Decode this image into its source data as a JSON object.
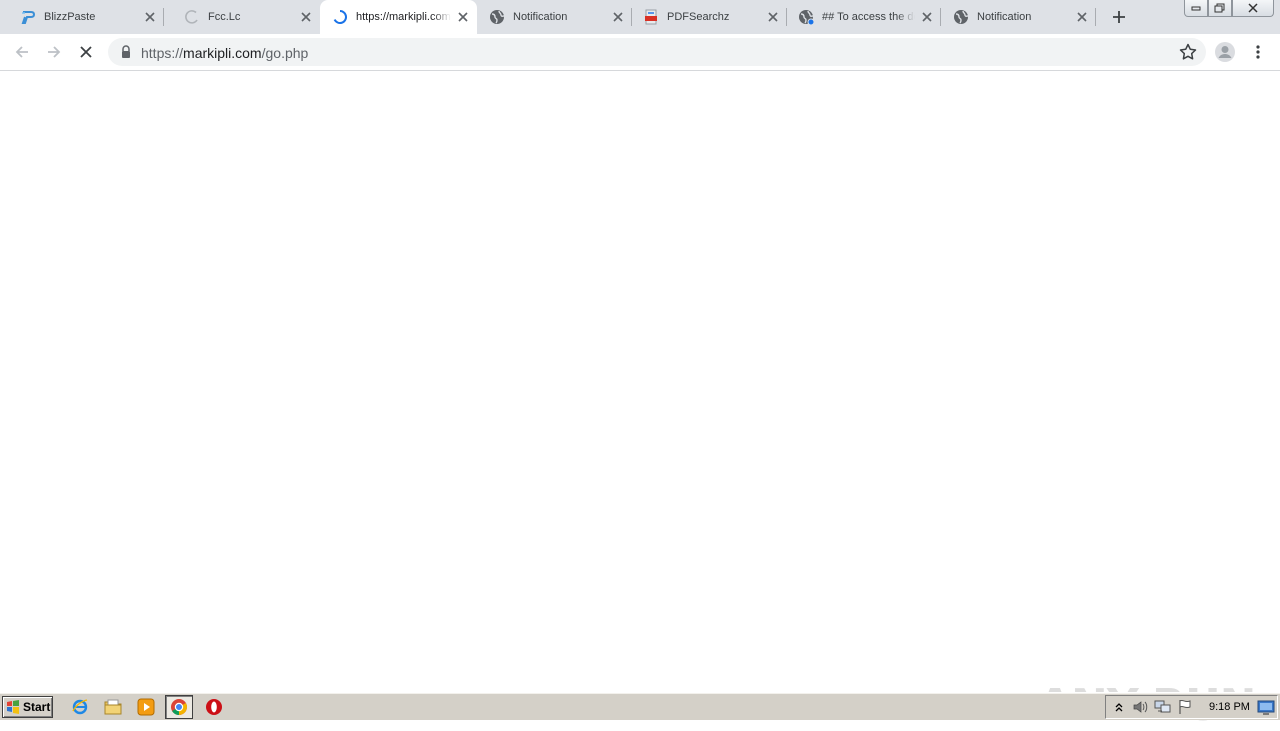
{
  "browser": {
    "tabs": [
      {
        "title": "BlizzPaste",
        "favicon": "blizzpaste-icon",
        "active": false
      },
      {
        "title": "Fcc.Lc",
        "favicon": "loading-spinner-icon",
        "active": false
      },
      {
        "title": "https://markipli.com/go.php",
        "favicon": "loading-spinner-icon",
        "active": true
      },
      {
        "title": "Notification",
        "favicon": "globe-icon",
        "active": false
      },
      {
        "title": "PDFSearchz",
        "favicon": "pdf-icon",
        "active": false
      },
      {
        "title": "## To access the document",
        "favicon": "globe-icon",
        "active": false
      },
      {
        "title": "Notification",
        "favicon": "globe-icon",
        "active": false
      }
    ],
    "address": {
      "scheme": "https://",
      "host": "markipli.com",
      "path": "/go.php"
    },
    "accent": "#1a73e8"
  },
  "watermark": {
    "text": "ANY RUN"
  },
  "taskbar": {
    "start_label": "Start",
    "clock": "9:18 PM"
  }
}
